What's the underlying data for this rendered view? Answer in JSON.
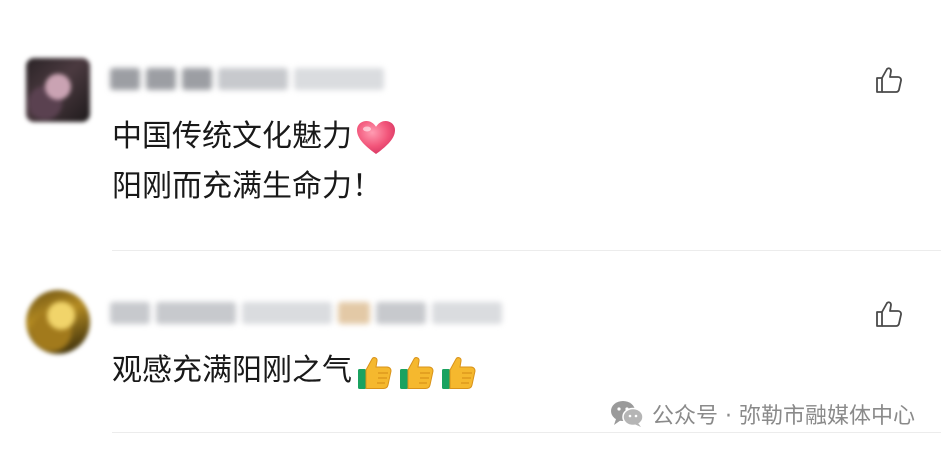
{
  "comments": [
    {
      "lines": [
        "中国传统文化魅力",
        "阳刚而充满生命力！"
      ],
      "emoji_after_line_1": "heart-icon"
    },
    {
      "lines": [
        "观感充满阳刚之气"
      ],
      "emoji_after_line_1": "thumbs-up-icon",
      "emoji_count": 3
    }
  ],
  "watermark": {
    "text": "公众号 · 弥勒市融媒体中心",
    "icon": "wechat-icon"
  },
  "colors": {
    "text": "#191919",
    "like_icon": "#4a4a4a",
    "watermark": "#8a8a8a",
    "heart": "#f2557a",
    "thumb": "#f5b82e",
    "cuff": "#1aa260"
  }
}
